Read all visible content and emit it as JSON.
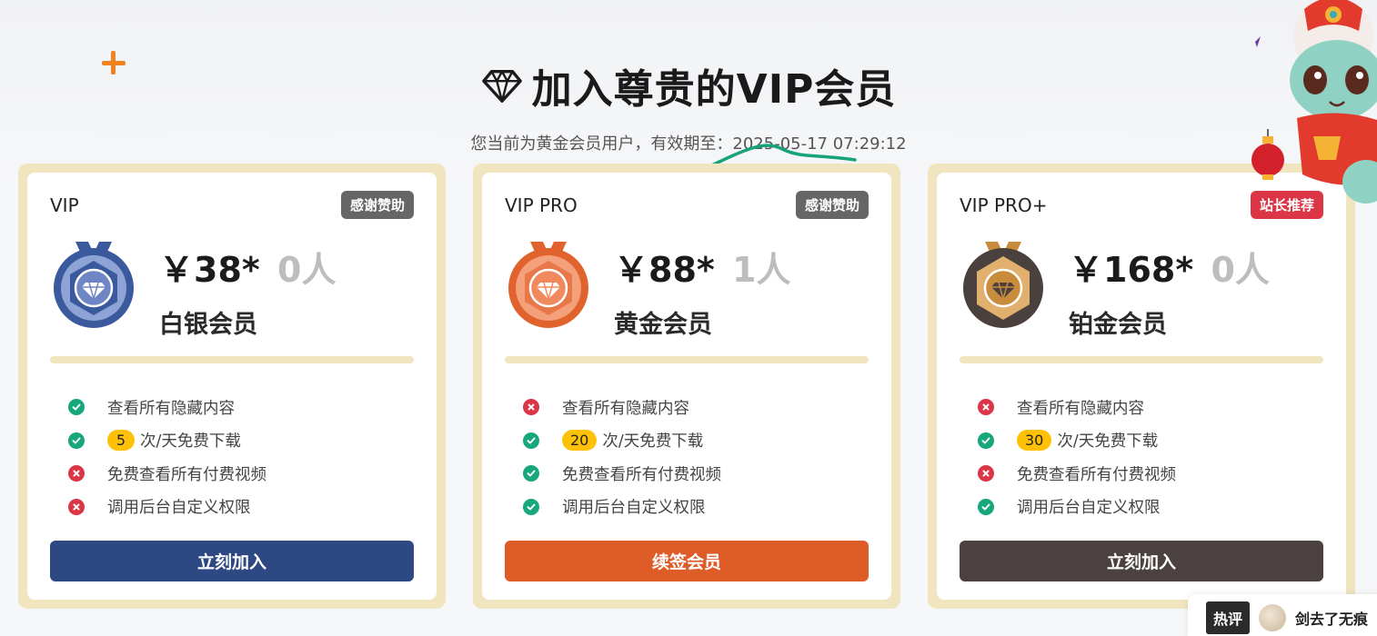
{
  "header": {
    "title": "加入尊贵的VIP会员",
    "subtitle": "您当前为黄金会员用户，有效期至：2025-05-17 07:29:12"
  },
  "plans": [
    {
      "tier": "VIP",
      "badge": "感谢赞助",
      "price": "￥38*",
      "count": "0人",
      "level": "白银会员",
      "download_count": "5",
      "features": [
        {
          "label": "查看所有隐藏内容",
          "status": "ok"
        },
        {
          "label": "次/天免费下载",
          "status": "ok"
        },
        {
          "label": "免费查看所有付费视频",
          "status": "no"
        },
        {
          "label": "调用后台自定义权限",
          "status": "no"
        }
      ],
      "button": "立刻加入",
      "colors": {
        "button": "#2d4882",
        "medal_outer": "#3b5a9e",
        "medal_inner": "#8fa4d6"
      }
    },
    {
      "tier": "VIP PRO",
      "badge": "感谢赞助",
      "price": "￥88*",
      "count": "1人",
      "level": "黄金会员",
      "download_count": "20",
      "features": [
        {
          "label": "查看所有隐藏内容",
          "status": "no"
        },
        {
          "label": "次/天免费下载",
          "status": "ok"
        },
        {
          "label": "免费查看所有付费视频",
          "status": "ok"
        },
        {
          "label": "调用后台自定义权限",
          "status": "ok"
        }
      ],
      "button": "续签会员",
      "colors": {
        "button": "#de5c28",
        "medal_outer": "#e0622c",
        "medal_inner": "#f4a07a"
      }
    },
    {
      "tier": "VIP PRO+",
      "badge": "站长推荐",
      "price": "￥168*",
      "count": "0人",
      "level": "铂金会员",
      "download_count": "30",
      "features": [
        {
          "label": "查看所有隐藏内容",
          "status": "no"
        },
        {
          "label": "次/天免费下载",
          "status": "ok"
        },
        {
          "label": "免费查看所有付费视频",
          "status": "no"
        },
        {
          "label": "调用后台自定义权限",
          "status": "ok"
        }
      ],
      "button": "立刻加入",
      "colors": {
        "button": "#4a4140",
        "medal_outer": "#4a403d",
        "medal_inner": "#e2b06e"
      }
    }
  ],
  "hot_comment": {
    "tag": "热评",
    "text": "剑去了无痕"
  },
  "icons": {
    "title": "diamond-icon",
    "ok": "check-circle-icon",
    "no": "x-circle-icon",
    "medal": "medal-icon"
  }
}
